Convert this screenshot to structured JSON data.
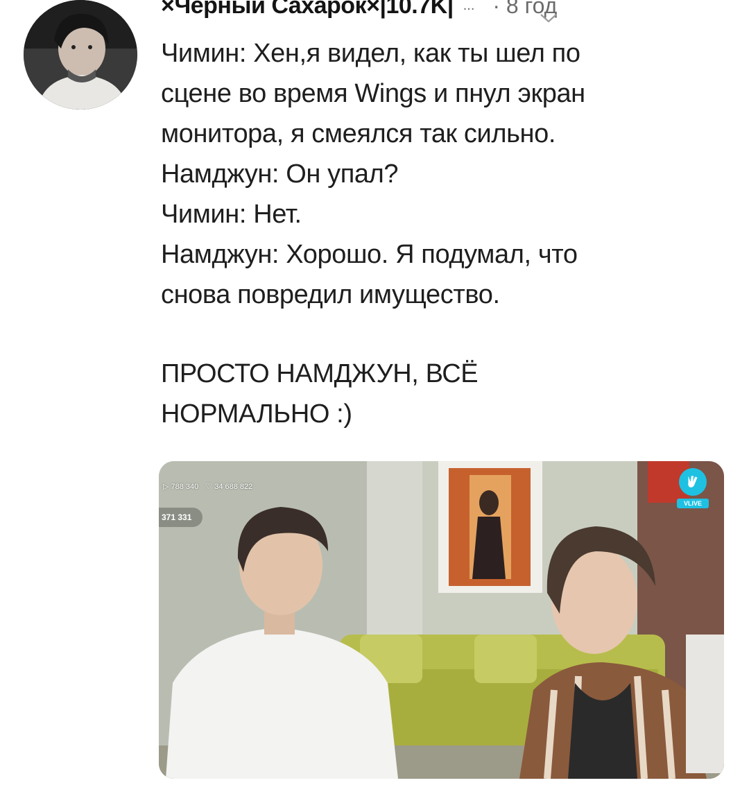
{
  "post": {
    "author": "×Чёрный Сахарок×|10.7K|",
    "more": "...",
    "time": "· 8 год",
    "menu_icon": "chevron-down-icon",
    "avatar_icon": "user-avatar",
    "lines": [
      "Чимин: Хен,я видел, как ты шел по",
      "сцене во время Wings и пнул экран",
      "монитора, я смеялся так сильно.",
      "Намджун: Он упал?",
      "Чимин: Нет.",
      "Намджун: Хорошо. Я подумал, что",
      "снова повредил имущество."
    ],
    "punchline": [
      "ПРОСТО НАМДЖУН, ВСЁ",
      "НОРМАЛЬНО :)"
    ]
  },
  "media": {
    "views": "▷ 788 340",
    "likes": "♡ 34 688 822",
    "viewers": "371 331",
    "badge": "VLIVE",
    "badge_color": "#1ec1e2"
  }
}
